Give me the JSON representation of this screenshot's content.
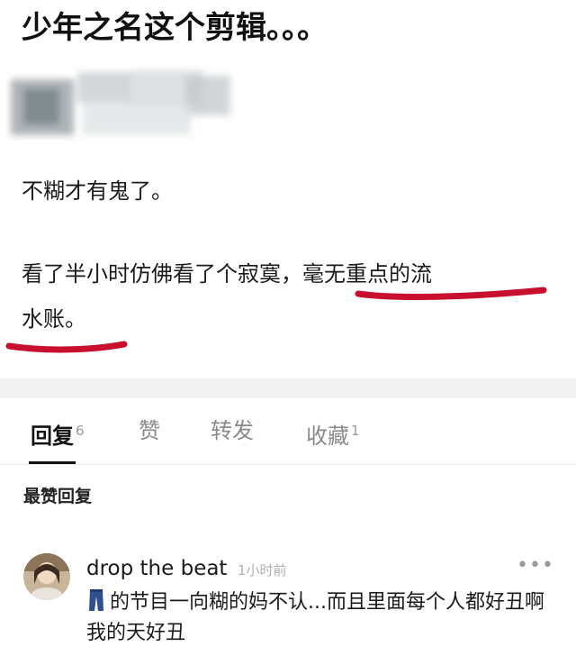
{
  "post": {
    "title": "少年之名这个剪辑。。。",
    "paragraph1": "不糊才有鬼了。",
    "paragraph2_line1": "看了半小时仿佛看了个寂寞，毫无重点的流",
    "paragraph2_line2": "水账。"
  },
  "tabs": [
    {
      "label": "回复",
      "count": "6"
    },
    {
      "label": "赞",
      "count": ""
    },
    {
      "label": "转发",
      "count": ""
    },
    {
      "label": "收藏",
      "count": "1"
    }
  ],
  "replies": {
    "section_title": "最赞回复",
    "items": [
      {
        "username": "drop the beat",
        "timestamp": "1小时前",
        "emoji_icon": "jeans-icon",
        "text": "的节目一向糊的妈不认...而且里面每个人都好丑啊我的天好丑"
      }
    ]
  },
  "colors": {
    "underline": "#c8102e",
    "active_tab": "#111111",
    "inactive_tab": "#8a8a8a",
    "timestamp": "#b0b0b0",
    "separator_band": "#f2f2f2"
  }
}
